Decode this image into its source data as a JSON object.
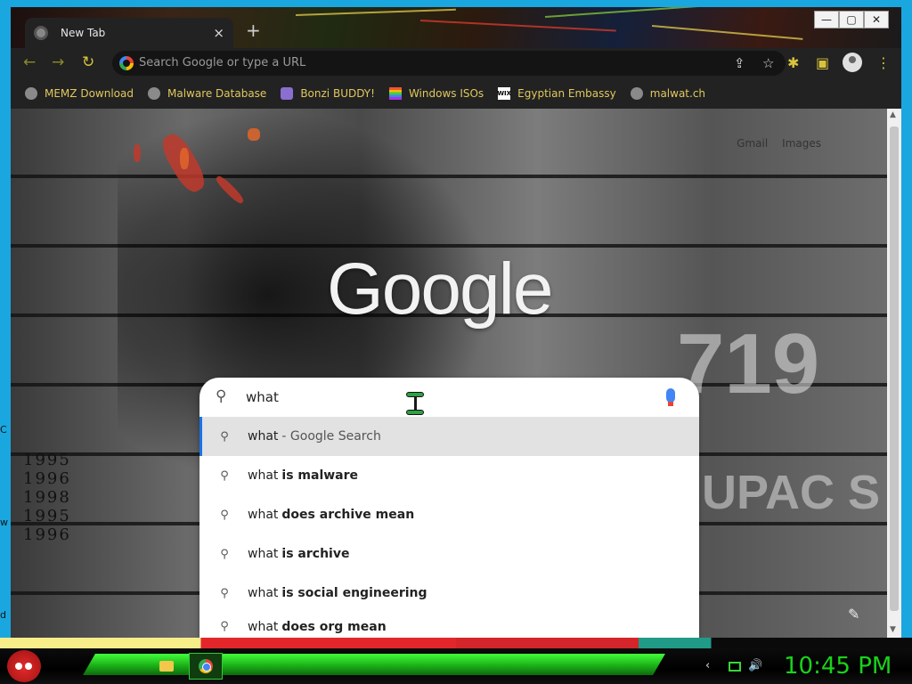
{
  "desktop": {
    "edge_letters": [
      "C",
      "w",
      "d"
    ]
  },
  "browser": {
    "tab": {
      "title": "New Tab",
      "close": "×"
    },
    "new_tab": "+",
    "window_controls": {
      "minimize": "—",
      "maximize": "▢",
      "close": "✕"
    },
    "toolbar": {
      "back": "←",
      "forward": "→",
      "reload": "↻",
      "omnibox_placeholder": "Search Google or type a URL",
      "share": "⇪",
      "star": "☆",
      "extensions": "✱",
      "side_panel": "▣",
      "menu": "⋮"
    },
    "bookmarks": [
      {
        "label": "MEMZ Download",
        "icon": "globe-icon"
      },
      {
        "label": "Malware Database",
        "icon": "globe-icon"
      },
      {
        "label": "Bonzi BUDDY!",
        "icon": "bonzi-icon"
      },
      {
        "label": "Windows ISOs",
        "icon": "rainbow-icon"
      },
      {
        "label": "Egyptian Embassy",
        "icon": "wix-icon",
        "glyph": "WIX"
      },
      {
        "label": "malwat.ch",
        "icon": "globe-icon"
      }
    ]
  },
  "page": {
    "top_links": [
      "Gmail",
      "Images"
    ],
    "logo": "Google",
    "background_text": {
      "years": [
        "1995",
        "1996",
        "1998",
        "1995",
        "1996"
      ],
      "big_number": "719",
      "partial_word": "UPAC S"
    },
    "search": {
      "query": "what",
      "search_icon": "⚲",
      "suggestions": [
        {
          "prefix": "what",
          "bold": "",
          "suffix": "- Google Search",
          "active": true
        },
        {
          "prefix": "what",
          "bold": "is malware",
          "suffix": ""
        },
        {
          "prefix": "what",
          "bold": "does archive mean",
          "suffix": ""
        },
        {
          "prefix": "what",
          "bold": "is archive",
          "suffix": ""
        },
        {
          "prefix": "what",
          "bold": "is social engineering",
          "suffix": ""
        },
        {
          "prefix": "what",
          "bold": "does org mean",
          "suffix": ""
        }
      ]
    },
    "customize_icon": "✎"
  },
  "taskbar": {
    "clock": "10:45 PM",
    "tray": {
      "chevron": "‹",
      "volume": "🔊"
    }
  },
  "colors": {
    "accent_green": "#19d319",
    "bookmark_text": "#e0c85e",
    "active_suggestion": "#e2e2e2",
    "selection_bar": "#1a73e8"
  }
}
